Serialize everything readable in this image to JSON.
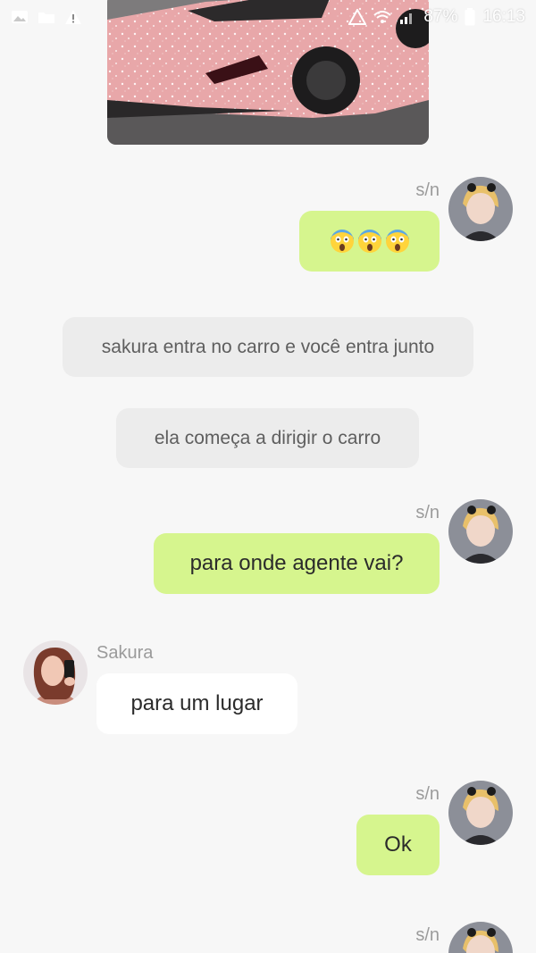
{
  "status_bar": {
    "battery": "87%",
    "time": "16:13",
    "left_icons": [
      "image-icon",
      "folder-icon",
      "warning-icon"
    ],
    "right_icons": [
      "vpn-warning-icon",
      "wifi-icon",
      "signal-icon",
      "battery-icon"
    ]
  },
  "chat": {
    "top_image": {
      "subject": "car-photo"
    },
    "messages": [
      {
        "type": "me",
        "sender": "s/n",
        "text": "😱😱😱"
      },
      {
        "type": "narration",
        "text": "sakura entra no carro e você entra junto"
      },
      {
        "type": "narration",
        "text": "ela começa a dirigir o carro"
      },
      {
        "type": "me",
        "sender": "s/n",
        "text": "para onde agente vai?"
      },
      {
        "type": "them",
        "sender": "Sakura",
        "text": "para um lugar"
      },
      {
        "type": "me",
        "sender": "s/n",
        "text": "Ok"
      },
      {
        "type": "me",
        "sender": "s/n",
        "text": ""
      }
    ]
  },
  "colors": {
    "background": "#f7f7f7",
    "my_bubble": "#d6f58e",
    "their_bubble": "#ffffff",
    "narration_bubble": "#ececec",
    "name_text": "#9b9b9b"
  }
}
